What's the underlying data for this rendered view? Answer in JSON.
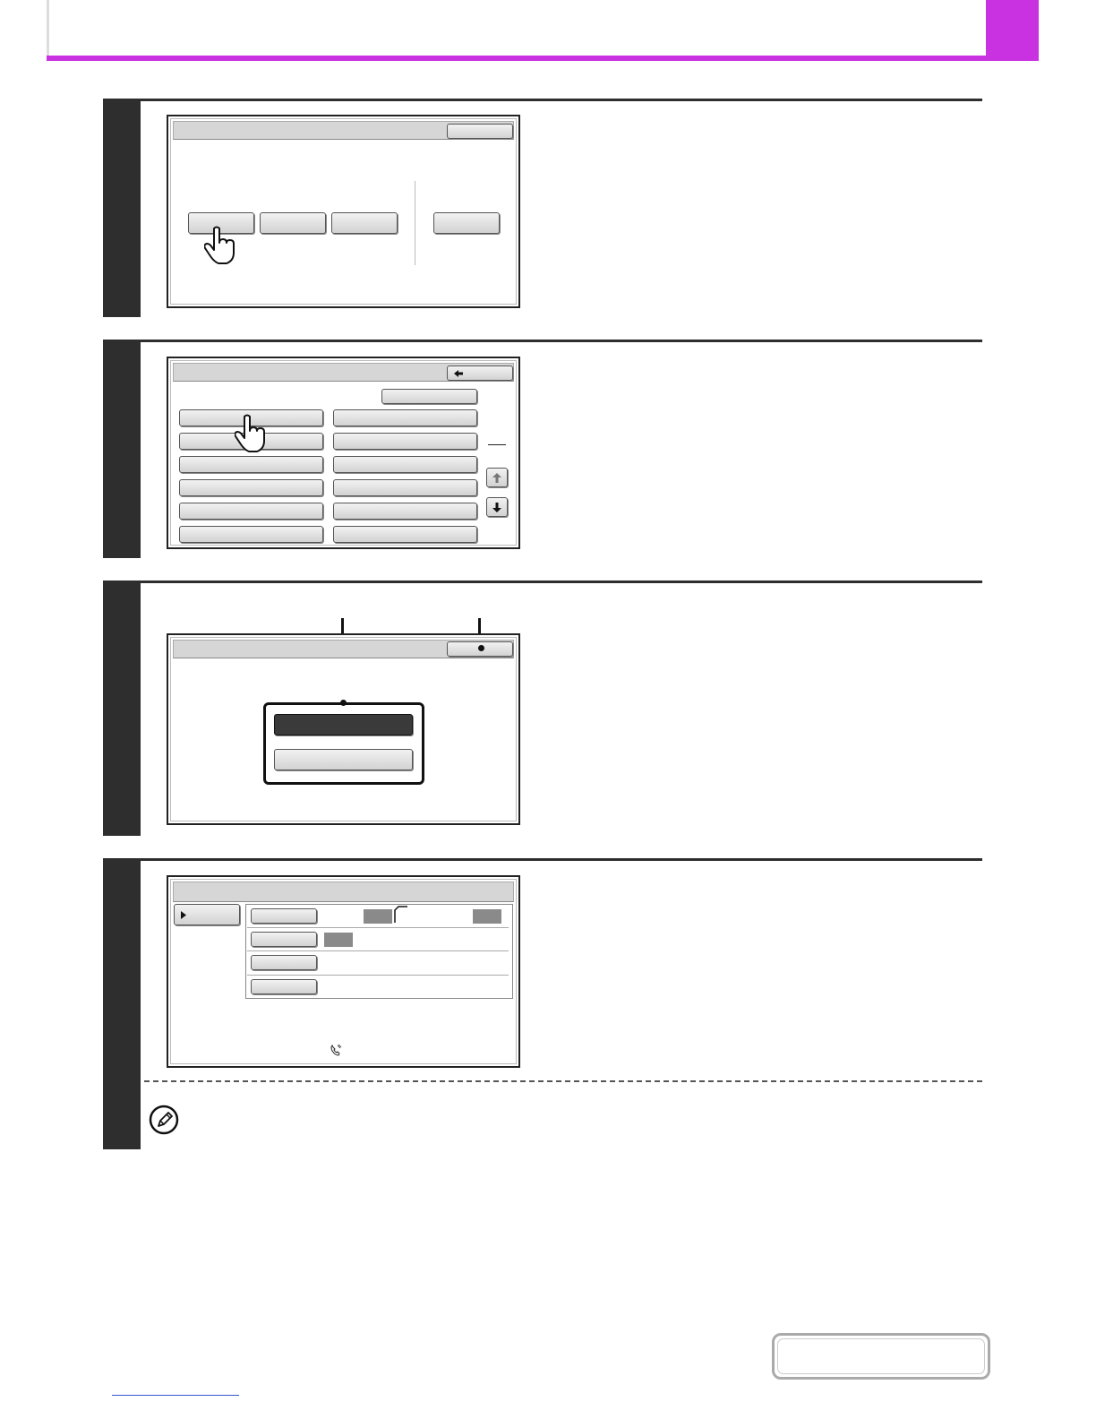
{
  "icons": [
    "hand-pointer-icon",
    "arrow-left-icon",
    "arrow-up-icon",
    "arrow-down-icon",
    "triangle-right-icon",
    "pencil-note-icon",
    "phone-handset-icon"
  ],
  "colors": {
    "accent": "#c832e0",
    "step_bar": "#2e2e2e"
  }
}
